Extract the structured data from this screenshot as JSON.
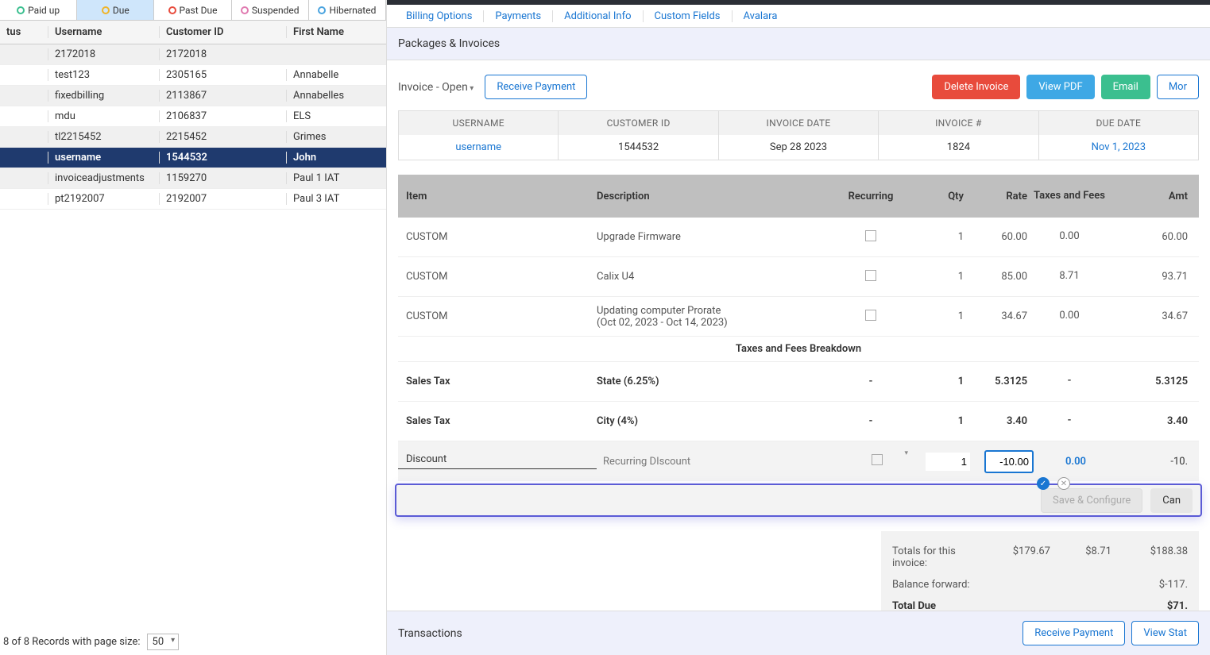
{
  "status_tabs": [
    {
      "label": "Paid up",
      "color": "#3bbf8f"
    },
    {
      "label": "Due",
      "color": "#f0b429"
    },
    {
      "label": "Past Due",
      "color": "#e84b3c"
    },
    {
      "label": "Suspended",
      "color": "#e07ab0"
    },
    {
      "label": "Hibernated",
      "color": "#4aa3df"
    }
  ],
  "active_status_tab": 1,
  "list_headers": {
    "status": "tus",
    "username": "Username",
    "customer_id": "Customer ID",
    "first_name": "First Name"
  },
  "customers": [
    {
      "username": "2172018",
      "customer_id": "2172018",
      "first_name": ""
    },
    {
      "username": "test123",
      "customer_id": "2305165",
      "first_name": "Annabelle"
    },
    {
      "username": "fixedbilling",
      "customer_id": "2113867",
      "first_name": "Annabelles"
    },
    {
      "username": "mdu",
      "customer_id": "2106837",
      "first_name": "ELS"
    },
    {
      "username": "tl2215452",
      "customer_id": "2215452",
      "first_name": "Grimes"
    },
    {
      "username": "username",
      "customer_id": "1544532",
      "first_name": "John"
    },
    {
      "username": "invoiceadjustments",
      "customer_id": "1159270",
      "first_name": "Paul 1 IAT"
    },
    {
      "username": "pt2192007",
      "customer_id": "2192007",
      "first_name": "Paul 3 IAT"
    }
  ],
  "selected_row_index": 5,
  "paging": {
    "text": "8 of 8 Records with page size:",
    "size": "50"
  },
  "sub_tabs": [
    "Billing Options",
    "Payments",
    "Additional Info",
    "Custom Fields",
    "Avalara"
  ],
  "section_title": "Packages & Invoices",
  "invoice_state": "Invoice - Open",
  "buttons": {
    "receive_payment": "Receive Payment",
    "delete_invoice": "Delete Invoice",
    "view_pdf": "View PDF",
    "email": "Email",
    "more": "Mor",
    "save_configure": "Save & Configure",
    "cancel": "Can",
    "view_stat": "View Stat"
  },
  "inv_summary_headers": {
    "username": "USERNAME",
    "customer_id": "CUSTOMER ID",
    "invoice_date": "INVOICE DATE",
    "invoice_no": "INVOICE #",
    "due_date": "DUE DATE"
  },
  "inv_summary": {
    "username": "username",
    "customer_id": "1544532",
    "invoice_date": "Sep 28 2023",
    "invoice_no": "1824",
    "due_date": "Nov 1, 2023"
  },
  "item_headers": {
    "item": "Item",
    "desc": "Description",
    "recurring": "Recurring",
    "qty": "Qty",
    "rate": "Rate",
    "tax": "Taxes and Fees",
    "amt": "Amt"
  },
  "items": [
    {
      "item": "CUSTOM",
      "desc": "Upgrade Firmware",
      "sub": "",
      "qty": "1",
      "rate": "60.00",
      "tax": "0.00",
      "amt": "60.00"
    },
    {
      "item": "CUSTOM",
      "desc": "Calix U4",
      "sub": "",
      "qty": "1",
      "rate": "85.00",
      "tax": "8.71",
      "amt": "93.71"
    },
    {
      "item": "CUSTOM",
      "desc": "Updating computer Prorate",
      "sub": "(Oct 02, 2023 - Oct 14, 2023)",
      "qty": "1",
      "rate": "34.67",
      "tax": "0.00",
      "amt": "34.67"
    }
  ],
  "breakdown_label": "Taxes and Fees Breakdown",
  "tax_rows": [
    {
      "item": "Sales Tax",
      "desc": "State (6.25%)",
      "rec": "-",
      "qty": "1",
      "rate": "5.3125",
      "tax": "-",
      "amt": "5.3125"
    },
    {
      "item": "Sales Tax",
      "desc": "City (4%)",
      "rec": "-",
      "qty": "1",
      "rate": "3.40",
      "tax": "-",
      "amt": "3.40"
    }
  ],
  "discount": {
    "item": "Discount",
    "desc": "Recurring DIscount",
    "qty": "1",
    "rate": "-10.00",
    "tax": "0.00",
    "amt": "-10."
  },
  "totals": {
    "label_totals": "Totals for this invoice:",
    "label_balance": "Balance forward:",
    "label_due": "Total Due",
    "sub": "$179.67",
    "tax": "$8.71",
    "total": "$188.38",
    "balance": "$-117.",
    "due": "$71."
  },
  "transactions_label": "Transactions"
}
